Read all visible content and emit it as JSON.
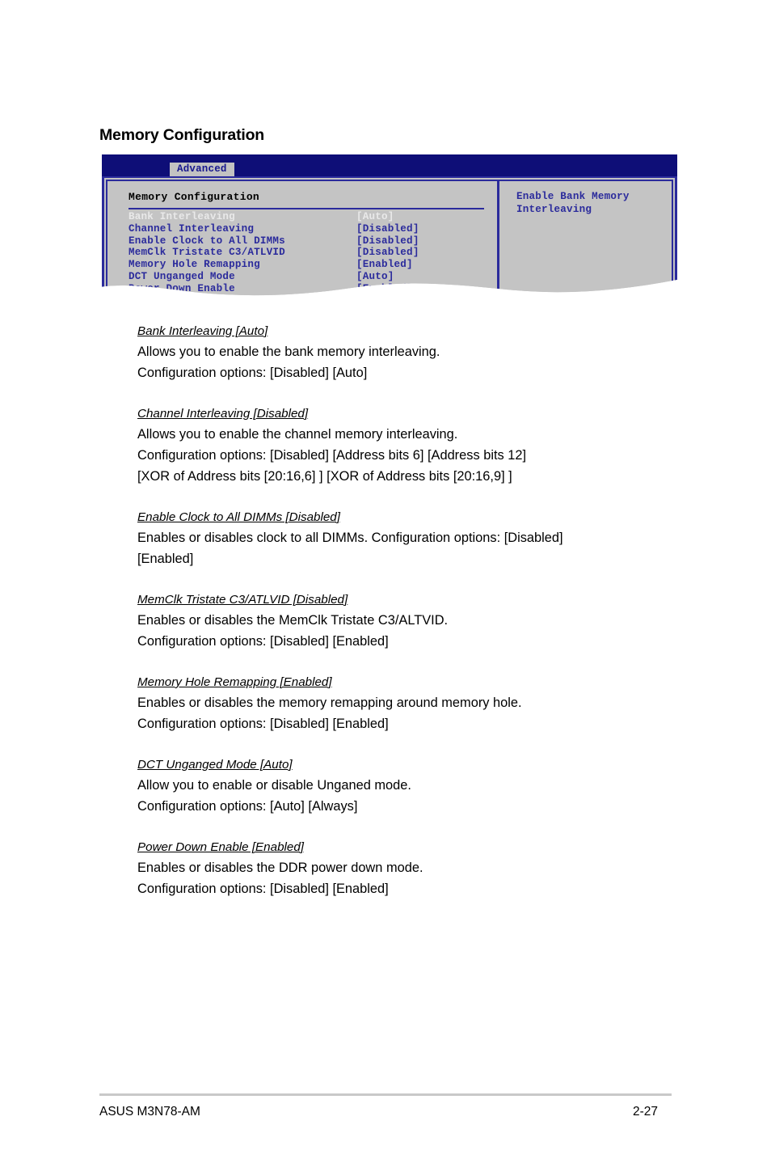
{
  "page": {
    "section_title": "Memory Configuration",
    "footer_left": "ASUS M3N78-AM",
    "footer_right": "2-27"
  },
  "bios": {
    "tab_label": "Advanced",
    "panel_heading": "Memory Configuration",
    "help_text": "Enable Bank Memory\nInterleaving",
    "colors": {
      "header_bg": "#0e0e77",
      "panel_bg": "#c4c4c4",
      "border": "#2b2b9c",
      "item_text": "#2b2b9c",
      "selected_text": "#e9e9e9",
      "tab_bg": "#c2c2c2"
    },
    "items": [
      {
        "label": "Bank Interleaving",
        "value": "[Auto]",
        "selected": true
      },
      {
        "label": "Channel Interleaving",
        "value": "[Disabled]",
        "selected": false
      },
      {
        "label": "Enable Clock to All DIMMs",
        "value": "[Disabled]",
        "selected": false
      },
      {
        "label": "MemClk Tristate C3/ATLVID",
        "value": "[Disabled]",
        "selected": false
      },
      {
        "label": "Memory Hole Remapping",
        "value": "[Enabled]",
        "selected": false
      },
      {
        "label": "DCT Unganged Mode",
        "value": "[Auto]",
        "selected": false
      },
      {
        "label": "Power Down Enable",
        "value": "[Enabled]",
        "selected": false
      }
    ]
  },
  "descriptions": [
    {
      "title": "Bank Interleaving [Auto]",
      "lines": [
        "Allows you to enable the bank memory interleaving.",
        "Configuration options: [Disabled] [Auto]"
      ]
    },
    {
      "title": "Channel Interleaving [Disabled]",
      "lines": [
        "Allows you to enable the channel memory interleaving.",
        "Configuration options: [Disabled] [Address bits 6] [Address bits 12]",
        "[XOR of Address bits [20:16,6] ] [XOR of Address bits [20:16,9] ]"
      ]
    },
    {
      "title": "Enable Clock to All DIMMs [Disabled]",
      "lines": [
        "Enables or disables clock to all DIMMs. Configuration options: [Disabled]",
        "[Enabled]"
      ]
    },
    {
      "title": "MemClk Tristate C3/ATLVID [Disabled]",
      "lines": [
        "Enables or disables the MemClk Tristate C3/ALTVID.",
        "Configuration options: [Disabled] [Enabled]"
      ]
    },
    {
      "title": "Memory Hole Remapping [Enabled]",
      "lines": [
        "Enables or disables the memory remapping around memory hole.",
        "Configuration options: [Disabled] [Enabled]"
      ]
    },
    {
      "title": "DCT Unganged Mode [Auto]",
      "lines": [
        "Allow you to enable or disable Unganed mode.",
        "Configuration options: [Auto] [Always]"
      ]
    },
    {
      "title": "Power Down Enable [Enabled]",
      "lines": [
        "Enables or disables the DDR power down mode.",
        "Configuration options: [Disabled] [Enabled]"
      ]
    }
  ]
}
